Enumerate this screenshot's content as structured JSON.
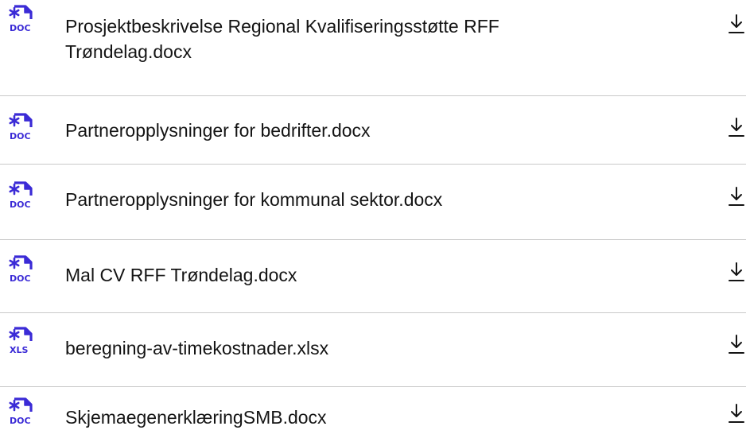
{
  "colors": {
    "icon_accent": "#3b2bd6",
    "text": "#141414",
    "divider": "#c9c9c9",
    "background": "#ffffff"
  },
  "files": [
    {
      "name": "Prosjektbeskrivelse Regional Kvalifiseringsstøtte RFF Trøndelag.docx",
      "type_label": "DOC",
      "icon": "doc-file-icon"
    },
    {
      "name": "Partneropplysninger for bedrifter.docx",
      "type_label": "DOC",
      "icon": "doc-file-icon"
    },
    {
      "name": "Partneropplysninger for kommunal sektor.docx",
      "type_label": "DOC",
      "icon": "doc-file-icon"
    },
    {
      "name": "Mal CV RFF Trøndelag.docx",
      "type_label": "DOC",
      "icon": "doc-file-icon"
    },
    {
      "name": "beregning-av-timekostnader.xlsx",
      "type_label": "XLS",
      "icon": "xls-file-icon"
    },
    {
      "name": "SkjemaegenerklæringSMB.docx",
      "type_label": "DOC",
      "icon": "doc-file-icon"
    }
  ],
  "download_icon": "download-icon"
}
